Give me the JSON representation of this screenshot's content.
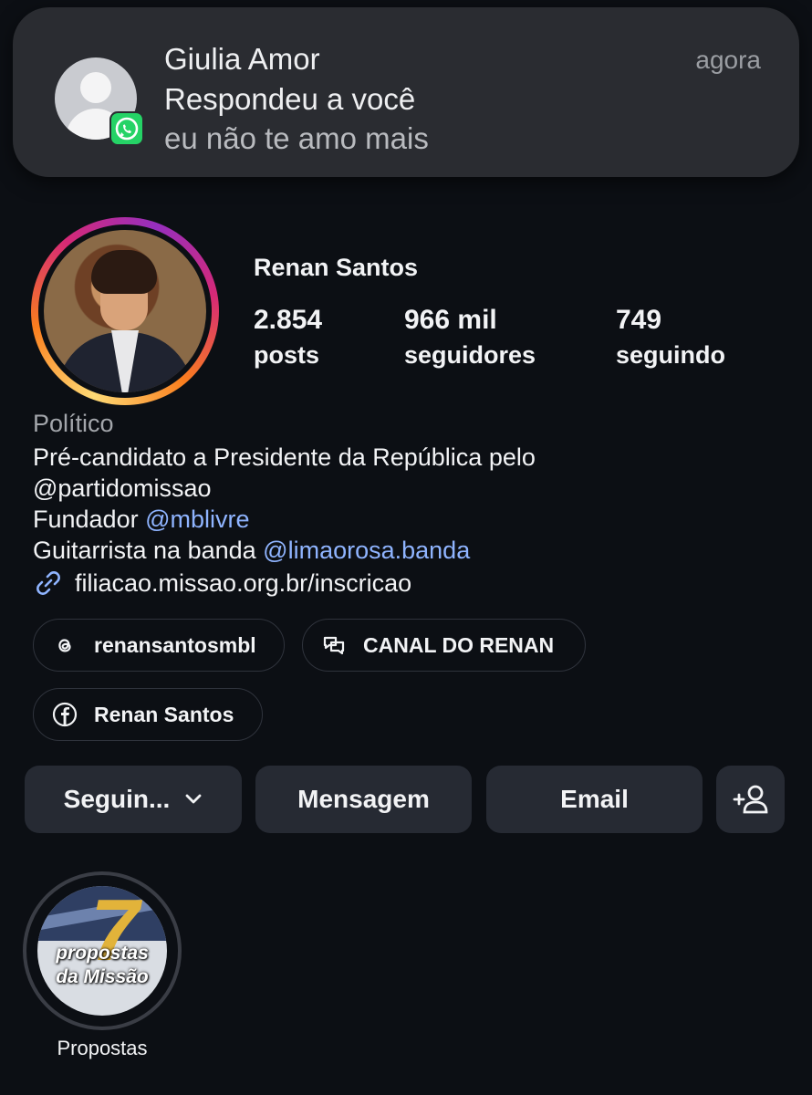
{
  "notification": {
    "title": "Giulia Amor",
    "subtitle": "Respondeu a você",
    "message": "eu não te amo mais",
    "time": "agora",
    "app_icon": "whatsapp-icon",
    "app_color": "#25d366"
  },
  "profile": {
    "name": "Renan Santos",
    "stats": [
      {
        "value": "2.854",
        "label": "posts"
      },
      {
        "value": "966 mil",
        "label": "seguidores"
      },
      {
        "value": "749",
        "label": "seguindo"
      }
    ],
    "category": "Político",
    "bio": {
      "line1": "Pré-candidato a Presidente da República pelo",
      "line2_mention": "@partidomissao",
      "line3_prefix": "Fundador",
      "line3_mention": "@mblivre",
      "line4_prefix": "Guitarrista na banda",
      "line4_mention": "@limaorosa.banda",
      "link": "filiacao.missao.org.br/inscricao"
    },
    "chips": [
      {
        "icon": "threads-icon",
        "label": "renansantosmbl"
      },
      {
        "icon": "channel-icon",
        "label": "CANAL DO RENAN"
      },
      {
        "icon": "facebook-icon",
        "label": "Renan Santos"
      }
    ],
    "buttons": {
      "following": "Seguin...",
      "message": "Mensagem",
      "email": "Email",
      "add_person_icon": "add-person-icon"
    },
    "highlights": [
      {
        "title": "Propostas",
        "cover_number": "7",
        "cover_line1": "propostas",
        "cover_line2": "da Missão"
      }
    ],
    "link_color": "#8fb4ff"
  }
}
